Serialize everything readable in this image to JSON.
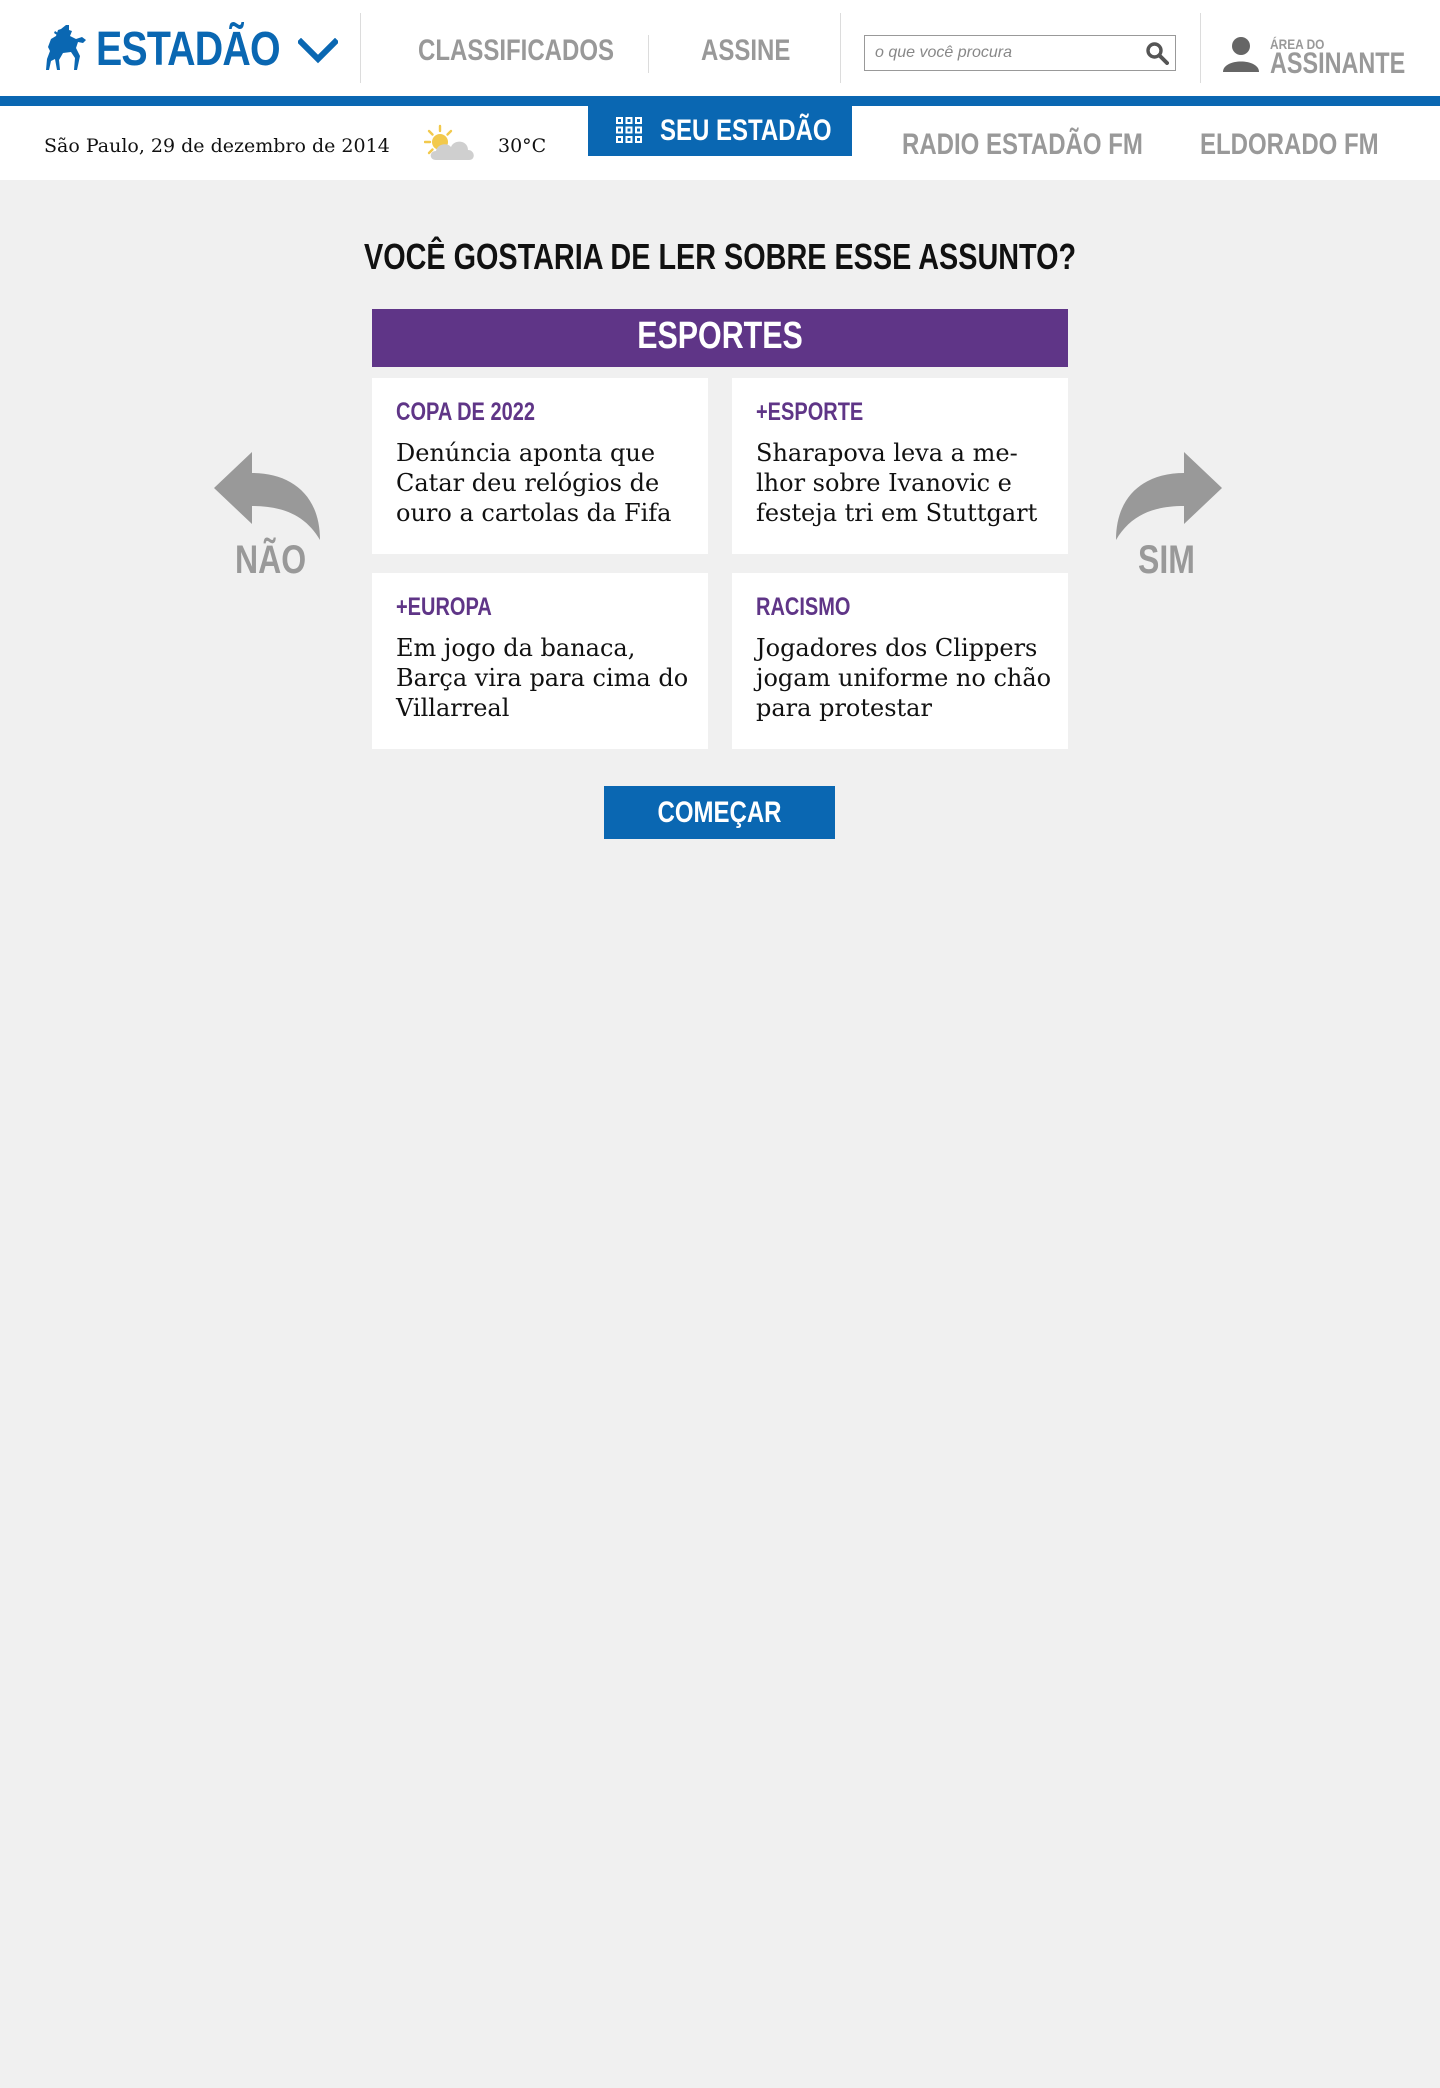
{
  "header": {
    "logo_text": "ESTADÃO",
    "nav": [
      {
        "label": "CLASSIFICADOS"
      },
      {
        "label": "ASSINE"
      }
    ],
    "search": {
      "placeholder": "o que você procura"
    },
    "account": {
      "small": "ÁREA DO",
      "big": "ASSINANTE"
    }
  },
  "subbar": {
    "date": "São Paulo, 29 de dezembro de 2014",
    "temperature": "30°C",
    "weather_icon": "partly-cloudy-icon",
    "seu_estadao": "SEU ESTADÃO",
    "links": [
      {
        "label": "RADIO ESTADÃO FM"
      },
      {
        "label": "ELDORADO FM"
      }
    ]
  },
  "main": {
    "question": "VOCÊ GOSTARIA DE LER SOBRE ESSE ASSUNTO?",
    "topic": "ESPORTES",
    "no_label": "NÃO",
    "yes_label": "SIM",
    "start_label": "COMEÇAR",
    "cards": [
      {
        "tag": "COPA DE 2022",
        "title": "Denúncia aponta que Catar deu relógios de ouro a cartolas da Fifa"
      },
      {
        "tag": "+ESPORTE",
        "title": "Sharapova leva a me­lhor sobre Ivanovic e festeja tri em Stuttgart"
      },
      {
        "tag": "+EUROPA",
        "title": "Em jogo da banaca, Barça vira para cima do Villarreal"
      },
      {
        "tag": "RACISMO",
        "title": "Jogadores dos Clippers jogam uniforme no chão para protestar"
      }
    ]
  },
  "colors": {
    "brand_blue": "#0a67b2",
    "topic_purple": "#5f3587",
    "muted_gray": "#999999",
    "page_bg": "#f0f0f0"
  }
}
